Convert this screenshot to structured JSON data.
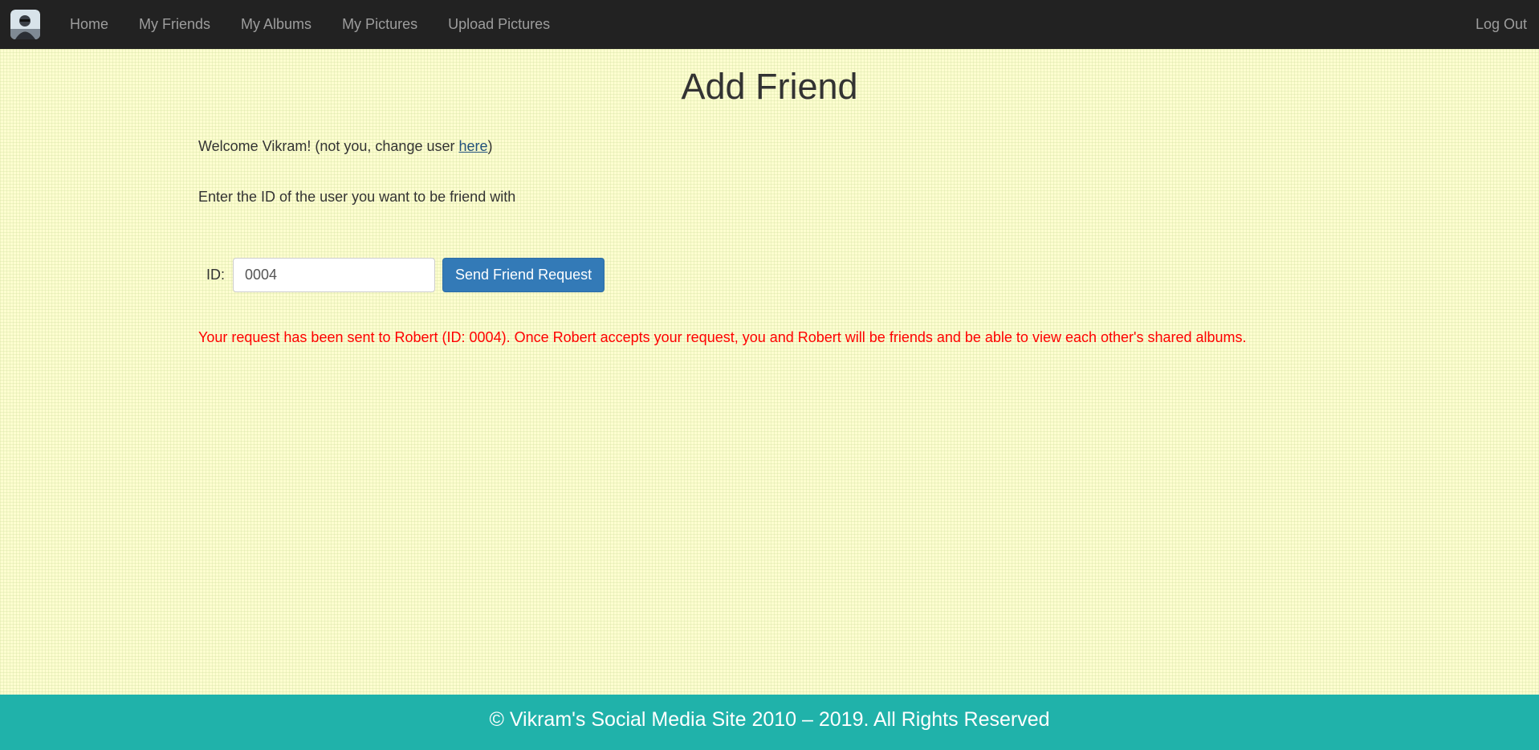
{
  "nav": {
    "logo_icon": "user-avatar-logo-icon",
    "items": [
      {
        "label": "Home"
      },
      {
        "label": "My Friends"
      },
      {
        "label": "My Albums"
      },
      {
        "label": "My Pictures"
      },
      {
        "label": "Upload Pictures"
      }
    ],
    "logout_label": "Log Out",
    "colors": {
      "background": "#222222",
      "text": "#9d9d9d"
    }
  },
  "page": {
    "title": "Add Friend",
    "welcome_prefix": "Welcome Vikram! (not you, change user ",
    "welcome_link": "here",
    "welcome_suffix": ")",
    "instructions": "Enter the ID of the user you want to be friend with"
  },
  "form": {
    "id_label": "ID:",
    "id_value": "0004",
    "submit_label": "Send Friend Request"
  },
  "status": {
    "message": "Your request has been sent to Robert (ID: 0004). Once Robert accepts your request, you and Robert will be friends and be able to view each other's shared albums.",
    "color": "#ff0000"
  },
  "footer": {
    "text": "© Vikram's Social Media Site 2010 – 2019. All Rights Reserved",
    "color": "#20b2aa"
  },
  "theme": {
    "background": "#fdfdd0",
    "primary_button": "#337ab7"
  }
}
